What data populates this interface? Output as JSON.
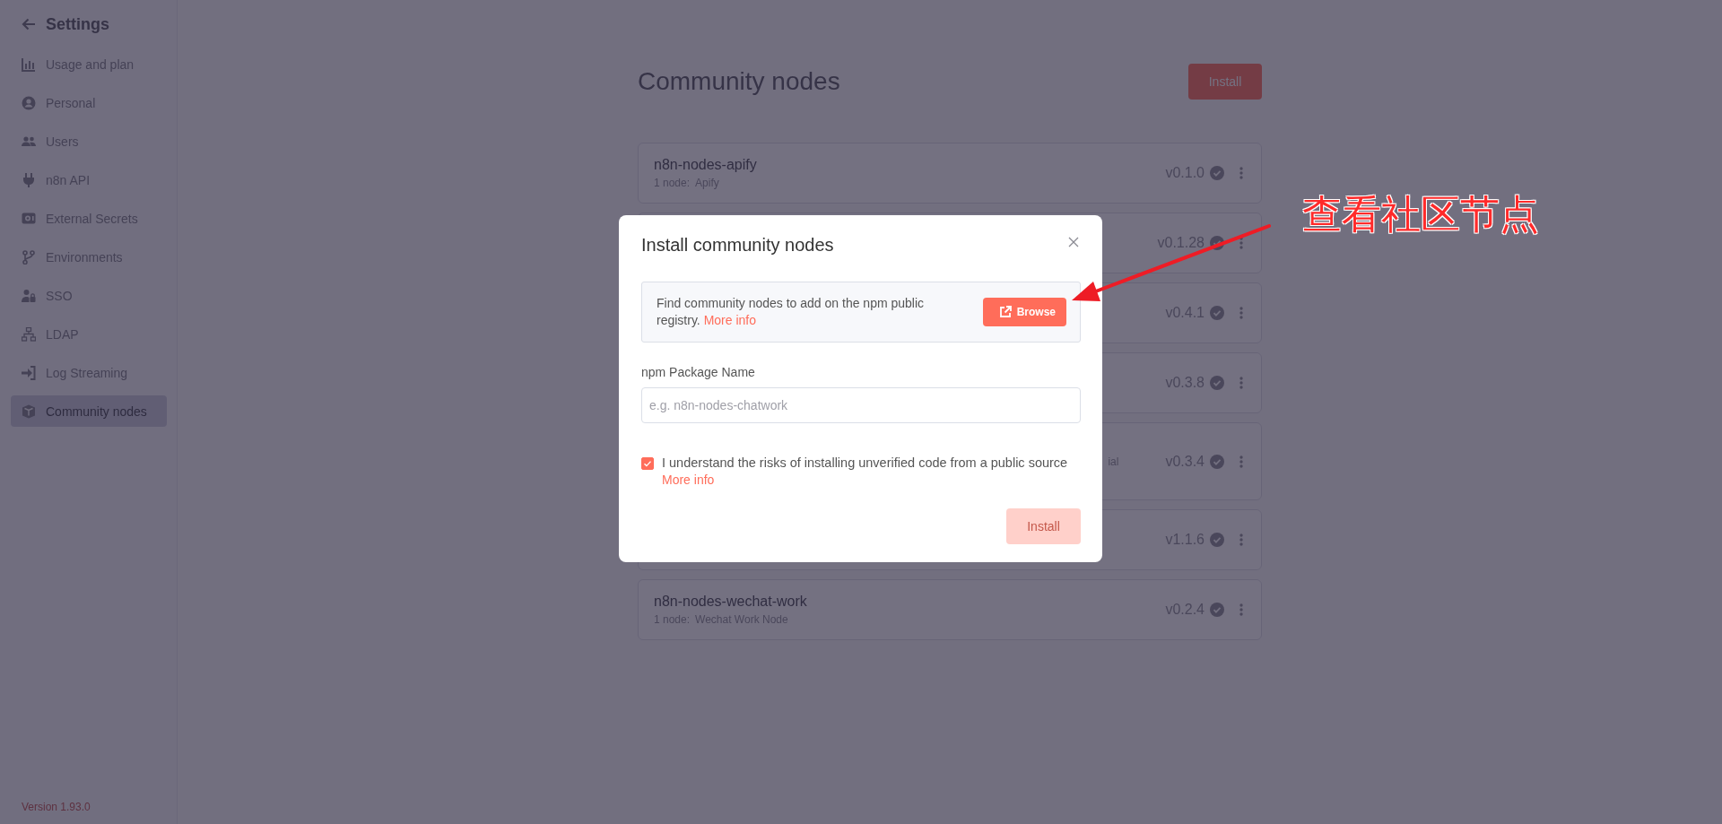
{
  "sidebar": {
    "title": "Settings",
    "items": [
      {
        "label": "Usage and plan",
        "selected": false
      },
      {
        "label": "Personal",
        "selected": false
      },
      {
        "label": "Users",
        "selected": false
      },
      {
        "label": "n8n API",
        "selected": false
      },
      {
        "label": "External Secrets",
        "selected": false
      },
      {
        "label": "Environments",
        "selected": false
      },
      {
        "label": "SSO",
        "selected": false
      },
      {
        "label": "LDAP",
        "selected": false
      },
      {
        "label": "Log Streaming",
        "selected": false
      },
      {
        "label": "Community nodes",
        "selected": true
      }
    ],
    "version": "Version 1.93.0"
  },
  "page": {
    "title": "Community nodes",
    "install_button": "Install",
    "packages": [
      {
        "name": "n8n-nodes-apify",
        "count": "1 node:",
        "nodes": "Apify",
        "version": "v0.1.0"
      },
      {
        "version": "v0.1.28"
      },
      {
        "version": "v0.4.1"
      },
      {
        "version": "v0.3.8"
      },
      {
        "detail": "ial",
        "version": "v0.3.4"
      },
      {
        "version": "v1.1.6"
      },
      {
        "name": "n8n-nodes-wechat-work",
        "count": "1 node:",
        "nodes": "Wechat Work Node",
        "version": "v0.2.4"
      }
    ]
  },
  "modal": {
    "title": "Install community nodes",
    "info": {
      "text": "Find community nodes to add on the npm public registry.",
      "link": "More info",
      "button": "Browse"
    },
    "field": {
      "label": "npm Package Name",
      "placeholder": "e.g. n8n-nodes-chatwork"
    },
    "consent": {
      "text": "I understand the risks of installing unverified code from a public source",
      "link": "More info",
      "checked": true
    },
    "install_button": {
      "label": "Install",
      "disabled": true
    }
  },
  "annotation": {
    "text": "查看社区节点"
  }
}
